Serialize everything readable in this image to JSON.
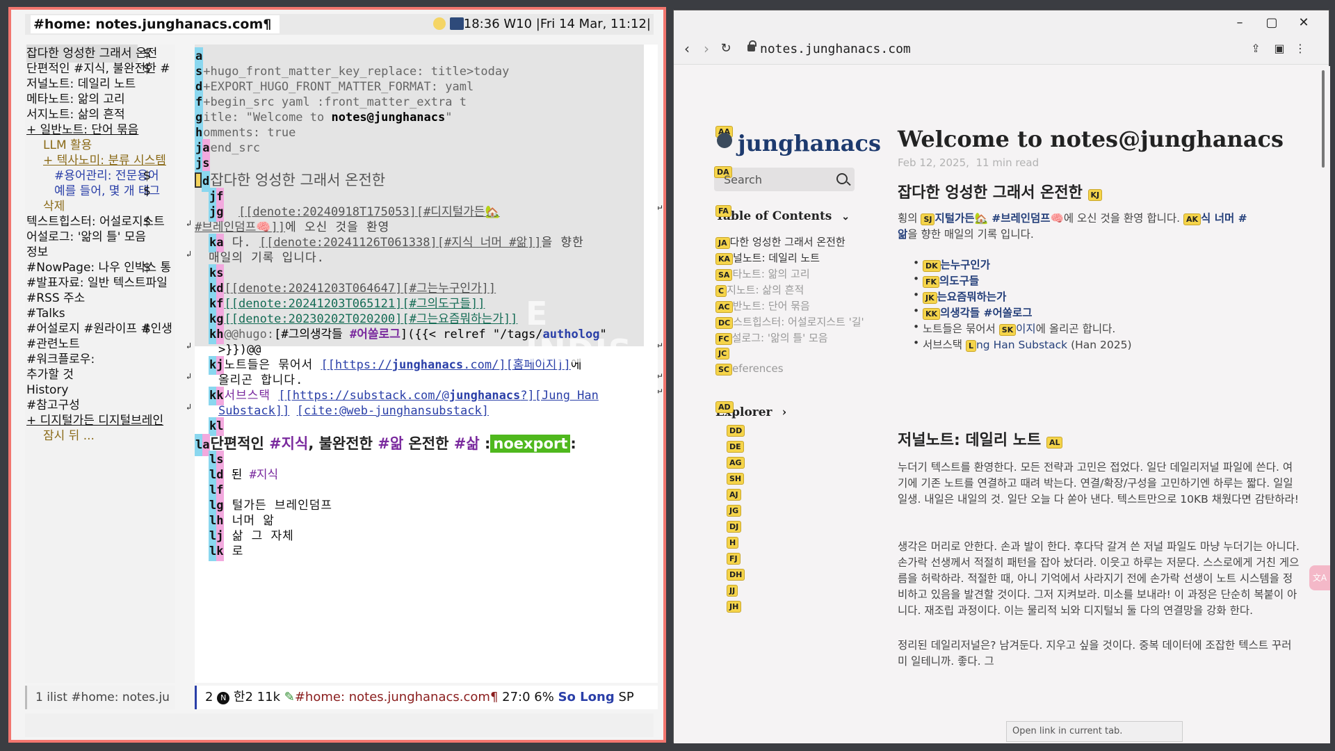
{
  "emacs": {
    "title": "#home: notes.junghanacs.com¶",
    "status_right": "18:36 W10 |Fri 14 Mar, 11:12|",
    "sidebar": [
      {
        "text": "잡다한 엉성한 그래서 온전",
        "dollar": "$",
        "level": 0,
        "selected": true
      },
      {
        "text": "단편적인 #지식, 불완전한 #",
        "dollar": "$",
        "level": 0
      },
      {
        "text": "저널노트: 데일리 노트",
        "level": 0
      },
      {
        "text": "메타노트: 앎의 고리",
        "level": 0
      },
      {
        "text": "서지노트: 삶의 흔적",
        "level": 0
      },
      {
        "text": "+ 일반노트: 단어 묶음",
        "level": 0,
        "style": "link"
      },
      {
        "text": "LLM 활용",
        "level": 1,
        "style": "gold"
      },
      {
        "text": "+ 텍사노미: 분류 시스템",
        "level": 1,
        "style": "gold-link"
      },
      {
        "text": "#용어관리: 전문용어",
        "dollar": "$",
        "level": 2,
        "style": "blue"
      },
      {
        "text": "예를 들어, 몇 개 태그",
        "dollar": "$",
        "level": 2,
        "style": "blue"
      },
      {
        "text": "삭제",
        "level": 1,
        "style": "gold"
      },
      {
        "text": "텍스트힙스터: 어설로지스트",
        "dollar": "$",
        "level": 0
      },
      {
        "text": "어설로그: '앎의 틀' 모음",
        "level": 0
      },
      {
        "text": "정보",
        "level": 0
      },
      {
        "text": "#NowPage: 나우 인박스 통",
        "dollar": "$",
        "level": 0
      },
      {
        "text": "#발표자료: 일반 텍스트파일",
        "level": 0
      },
      {
        "text": "#RSS 주소",
        "level": 0
      },
      {
        "text": "#Talks",
        "level": 0
      },
      {
        "text": "#어설로지 #원라이프 #인생",
        "dollar": "$",
        "level": 0
      },
      {
        "text": "#관련노트",
        "level": 0
      },
      {
        "text": "#워크플로우:",
        "level": 0
      },
      {
        "text": "추가할 것",
        "level": 0
      },
      {
        "text": "History",
        "level": 0
      },
      {
        "text": "#참고구성",
        "level": 0
      },
      {
        "text": "+ 디지털가든 디지털브레인",
        "level": 0,
        "style": "link"
      },
      {
        "text": "잠시 뒤 ...",
        "level": 1,
        "style": "gold"
      }
    ],
    "sidebar_mode": "1   ilist #home: notes.ju",
    "editor": {
      "l1_key": "a",
      "l2_key": "s",
      "l2_text": "+hugo_front_matter_key_replace: title>today",
      "l3_key": "d",
      "l3_text": "+EXPORT_HUGO_FRONT_MATTER_FORMAT: yaml",
      "l4_key": "f",
      "l4_text": "+begin_src yaml :front_matter_extra t",
      "l5_key": "g",
      "l5_text_a": "itle: \"Welcome to ",
      "l5_text_b": "notes@junghanacs",
      "l5_text_c": "\"",
      "l6_key": "h",
      "l6_text": "omments: true",
      "l7_key": "ja",
      "l7_text": "end_src",
      "l8_key": "js",
      "l9_key": "d",
      "l9_text": "잡다한 엉성한 그래서 온전한",
      "l10_key": "jf",
      "l11_key": "jg",
      "l11_link": "[[denote:20240918T175053][#디지털가든🏡",
      "l12_link": "#브레인덤프🧠]]",
      "l12_text": "에 오신 것을 환영",
      "l13_key": "ka",
      "l13_text": " 다. ",
      "l13_link": "[[denote:20241126T061338][#지식 너머 #앎]]",
      "l13_tail": "을 향한",
      "l14_text": "매일의 기록 입니다.",
      "l15_key": "ks",
      "l16_key": "kd",
      "l16_link": "[[denote:20241203T064647][#그는누구인가]]",
      "l17_key": "kf",
      "l17_link": "[[denote:20241203T065121][#그의도구들]]",
      "l18_key": "kg",
      "l18_link": "[[denote:20230202T020200][#그는요즘뭐하는가]]",
      "l19_key": "kh",
      "l19_a": "@@hugo:",
      "l19_b": "[#그의생각들 ",
      "l19_c": "#어쏠로그",
      "l19_d": "]({{< relref \"/tags/",
      "l19_e": "autholog",
      "l19_f": "\"",
      "l20_text": ">}})@@",
      "l21_key": "kj",
      "l21_text": "노트들은 묶어서 ",
      "l21_link_a": "[[https://",
      "l21_link_b": "junghanacs",
      "l21_link_c": ".com/][홈페이지]]",
      "l21_tail": "에",
      "l22_text": "올리곤 합니다.",
      "l23_key": "kk",
      "l23_text": "서브스택 ",
      "l23_link_a": "[[https://substack.com/@",
      "l23_link_b": "junghanacs",
      "l23_link_c": "?][Jung Han",
      "l24_link": "Substack]]",
      "l24_cite": "[cite:@web-junghansubstack]",
      "l25_key": "kl",
      "l26_key": "la",
      "l26_a": "단편적인 ",
      "l26_b": "#지식",
      "l26_c": ", 불완전한 ",
      "l26_d": "#앎",
      "l26_e": " 온전한 ",
      "l26_f": "#삶",
      "l26_g": " :",
      "l26_noexport": "noexport",
      "l26_h": ":",
      "l27_key": "ls",
      "l28_key": "ld",
      "l28_a": " 된 ",
      "l28_b": "#지식",
      "l29_key": "lf",
      "l30_key": "lg",
      "l30_text": " 털가든 브레인덤프",
      "l31_key": "lh",
      "l31_text": "  너머 앎",
      "l32_key": "lj",
      "l32_text": "  삶 그 자체",
      "l33_key": "lk",
      "l33_text": " 로"
    },
    "watermark": "E INDIS",
    "modeline": {
      "num": "2",
      "n_icon": "N",
      "lang": "한2",
      "size": "11k",
      "buffer": "#home: notes.junghanacs.com¶",
      "pos": "27:0",
      "pct": "6%",
      "mode": "So Long",
      "tail": "SP"
    }
  },
  "browser": {
    "url": "notes.junghanacs.com",
    "site_name": "junghanacs",
    "logo_hint": "AA",
    "search_hint": "DA",
    "search_placeholder": "Search",
    "toc_hint": "FA",
    "toc_title": "Table of Contents",
    "toc_items": [
      {
        "hint": "JA",
        "text": "다한 엉성한 그래서 온전한",
        "faded": false
      },
      {
        "hint": "KA",
        "text": "널노트: 데일리 노트",
        "faded": false
      },
      {
        "hint": "SA",
        "text": "타노트: 앎의 고리",
        "faded": true
      },
      {
        "hint": "C",
        "text": "지노트: 삶의 흔적",
        "faded": true
      },
      {
        "hint": "AC",
        "text": "반노트: 단어 묶음",
        "faded": true
      },
      {
        "hint": "DC",
        "text": "스트힙스터: 어설로지스트 '길'",
        "faded": true
      },
      {
        "hint": "FC",
        "text": "설로그: '앎의 틀' 모음",
        "faded": true
      },
      {
        "hint": "JC",
        "text": "",
        "faded": true
      },
      {
        "hint": "SC",
        "text": "eferences",
        "faded": true
      }
    ],
    "explorer_hint": "AD",
    "explorer_title": "Explorer",
    "explorer_hints": [
      "DD",
      "DE",
      "AG",
      "SH",
      "AJ",
      "JG",
      "DJ",
      "H",
      "FJ",
      "DH",
      "JJ",
      "JH"
    ],
    "post_title": "Welcome to notes@junghanacs",
    "post_date": "Feb 12, 2025,",
    "post_read": "11 min read",
    "h2_1": "잡다한 엉성한 그래서 온전한",
    "h2_1_hint": "KJ",
    "p1": {
      "a": "횡의 ",
      "hint1": "SJ",
      "b": "지털가든🏡 ",
      "tag1": "#브레인덤프",
      "c": "🧠에 오신 것을 환영 합니다. ",
      "hint2": "AK",
      "tag2": "식 너머 #",
      "d": "앎",
      "e": "을 향한 매일의 기록 입니다."
    },
    "list1": [
      {
        "hint": "DK",
        "text": "는누구인가",
        "tag": true
      },
      {
        "hint": "FK",
        "text": "의도구들",
        "tag": true
      },
      {
        "hint": "JK",
        "text": "는요즘뭐하는가",
        "tag": true
      },
      {
        "hint": "KK",
        "text": "의생각들 #어쏠로그",
        "tag": true
      },
      {
        "pre": "노트들은 묶어서 ",
        "hint": "SK",
        "text": "이지",
        "post": "에 올리곤 합니다.",
        "tag": true
      },
      {
        "pre": "서브스택 ",
        "hint": "L",
        "text": "ng Han Substack",
        "post": " (Han 2025)",
        "tag": true
      }
    ],
    "h2_2": "저널노트: 데일리 노트",
    "h2_2_hint": "AL",
    "p2": "누더기 텍스트를 환영한다. 모든 전략과 고민은 접었다. 일단 데일리저널 파일에 쓴다. 여기에 기존 노트를 연결하고 때려 박는다. 연결/확장/구성을 고민하기엔 하루는 짧다. 일일일생. 내일은 내일의 것. 일단 오늘 다 쏟아 낸다. 텍스트만으로 10KB 채웠다면 감탄하라!",
    "p3": "생각은 머리로 안한다. 손과 발이 한다. 후다닥 갈겨 쓴 저널 파일도 마냥 누더기는 아니다. 손가락 선생께서 적절히 패턴을 잡아 놨더라. 이읏고 하루는 저문다. 스스로에게 거친 게으름을 허락하라. 적절한 때, 아니 기억에서 사라지기 전에 손가락 선생이 노트 시스템을 정비하고 있음을 발견할 것이다. 그저 지켜보라. 미소를 보내라! 이 과정은 단순히 복붙이 아니다. 재조립 과정이다. 이는 물리적 뇌와 디지털뇌 둘 다의 연결망을 강화 한다.",
    "p4": "정리된 데일리저널은? 남겨둔다. 지우고 싶을 것이다. 중복 데이터에 조잡한 텍스트 꾸러미 일테니까. 좋다. 그",
    "status_popup": "Open link in current tab.",
    "side_tab": "文A"
  }
}
